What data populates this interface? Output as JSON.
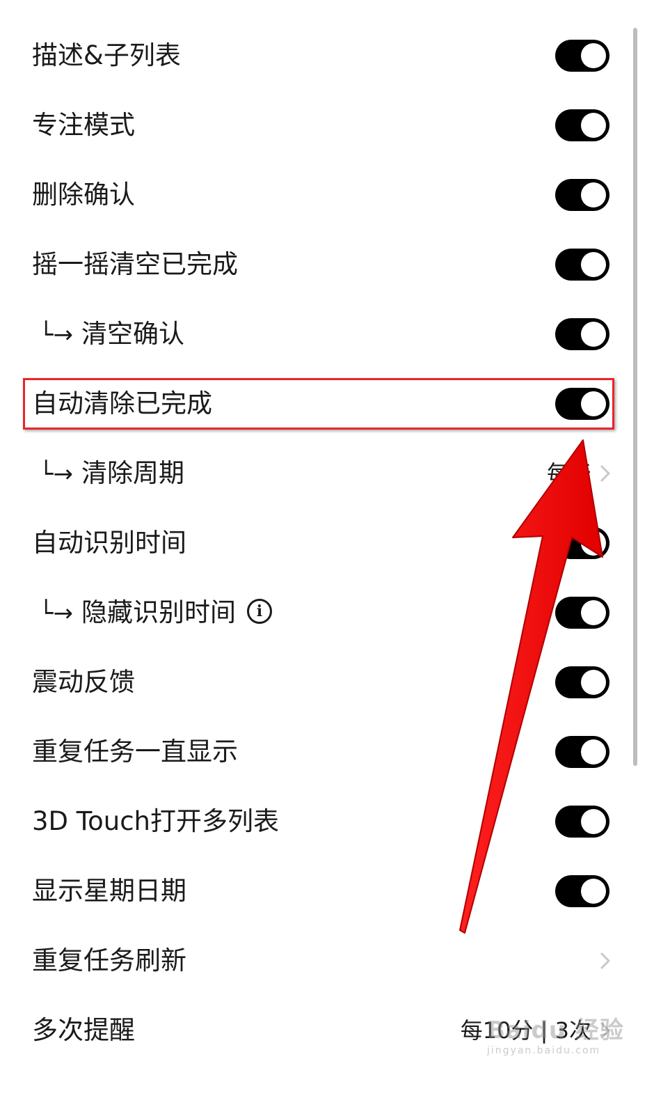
{
  "settings": [
    {
      "label": "描述&子列表",
      "control": "toggle",
      "on": true,
      "sub": false
    },
    {
      "label": "专注模式",
      "control": "toggle",
      "on": true,
      "sub": false
    },
    {
      "label": "删除确认",
      "control": "toggle",
      "on": true,
      "sub": false
    },
    {
      "label": "摇一摇清空已完成",
      "control": "toggle",
      "on": true,
      "sub": false
    },
    {
      "label": "清空确认",
      "control": "toggle",
      "on": true,
      "sub": true
    },
    {
      "label": "自动清除已完成",
      "control": "toggle",
      "on": true,
      "sub": false,
      "highlighted": true
    },
    {
      "label": "清除周期",
      "control": "chevron",
      "value": "每天",
      "sub": true
    },
    {
      "label": "自动识别时间",
      "control": "toggle",
      "on": true,
      "sub": false
    },
    {
      "label": "隐藏识别时间",
      "control": "toggle",
      "on": true,
      "sub": true,
      "info_icon": "info-circle-icon"
    },
    {
      "label": "震动反馈",
      "control": "toggle",
      "on": true,
      "sub": false
    },
    {
      "label": "重复任务一直显示",
      "control": "toggle",
      "on": true,
      "sub": false
    },
    {
      "label": "3D Touch打开多列表",
      "control": "toggle",
      "on": true,
      "sub": false
    },
    {
      "label": "显示星期日期",
      "control": "toggle",
      "on": true,
      "sub": false
    },
    {
      "label": "重复任务刷新",
      "control": "chevron",
      "value": "",
      "sub": false
    },
    {
      "label": "多次提醒",
      "control": "chevron",
      "value": "每10分 | 3次",
      "sub": false
    }
  ],
  "sub_prefix": "└→",
  "info_glyph": "i",
  "annotation": {
    "highlight_color": "#e8262b",
    "arrow_color": "#ff0000",
    "arrow_target": "自动清除已完成"
  },
  "watermark": {
    "main": "Baidu 经验",
    "sub": "jingyan.baidu.com"
  },
  "colors": {
    "toggle_on": "#000000",
    "knob": "#ffffff",
    "chevron": "#c7c7cc",
    "text": "#1a1a1a"
  }
}
